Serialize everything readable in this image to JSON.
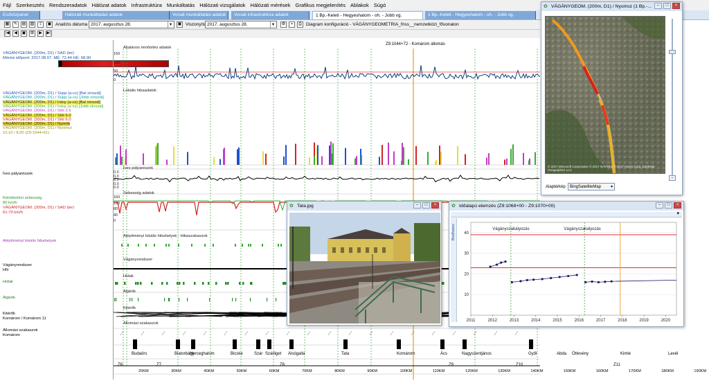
{
  "menu": [
    "Fájl",
    "Szerkesztés",
    "Rendszeradatok",
    "Hálózat adatok",
    "Infrastruktúra",
    "Munkáltatás",
    "Hálózati vizsgálatok",
    "Hálózati mérések",
    "Grafikus megjelenítés",
    "Ablakok",
    "Súgó"
  ],
  "tabs": [
    {
      "label": "Eszközpanel",
      "state": "ghost"
    },
    {
      "label": "Hálózati munkáltatási adatok",
      "state": "ghost"
    },
    {
      "label": "Vonali munkáltatási adatok",
      "state": "ghost"
    },
    {
      "label": "Vonali infrastruktúra adatok",
      "state": "ghost"
    },
    {
      "label": "1 Bp.-Keleti - Hegyeshalom - oh. - Jobb vg.",
      "state": "active"
    },
    {
      "label": "1 Bp.-Keleti - Hegyeshalom - oh. - Jobb vg.",
      "state": "ghost"
    }
  ],
  "toolbar": {
    "analysis_label": "Analízis dátuma",
    "analysis_date": "2017.  augusztus  28.",
    "ref_label": "Viszonyítási dátum",
    "ref_date": "2017.  augusztus  28.",
    "diagram_config": "Diagram konfiguráció - VÁGÁNYGEOMETRIA_friss__nemzetközi_fővonalon"
  },
  "left_panel": {
    "header1": "VÁGÁNYGEOM. (200m, D1) / SAD (ter)",
    "header2": "Mérési időpont: 2017.08.07.  MÉ: 72,44  HÉ: 68,90",
    "legend": [
      {
        "text": "VÁGÁNYGEOM. (200m, D1) / Süpp (a-cs) [Bal sínszál]",
        "color": "#1f4fd0",
        "bg": ""
      },
      {
        "text": "VÁGÁNYGEOM. (200m, D1) / Süpp (a-cs) [Jobb sínszál]",
        "color": "#0a9ea8",
        "bg": ""
      },
      {
        "text": "VÁGÁNYGEOM. (200m, D1) / Irány (a-cs) [Bal sínszál]",
        "color": "#222",
        "bg": "#f2ee4b"
      },
      {
        "text": "VÁGÁNYGEOM. (200m, D1) / Irány (a-cs) [Jobb sínszál]",
        "color": "#38a836",
        "bg": ""
      },
      {
        "text": "VÁGÁNYGEOM. (200m, D1) / Síkt 2.5",
        "color": "#c33bc3",
        "bg": ""
      },
      {
        "text": "VÁGÁNYGEOM. (200m, D1) / Síkt 6.0",
        "color": "#222",
        "bg": "#f2ee4b"
      },
      {
        "text": "VÁGÁNYGEOM. (200m, D1) / Síkt 6.0",
        "color": "#d02222",
        "bg": ""
      },
      {
        "text": "VÁGÁNYGEOM. (200m, D1) / Nyomb",
        "color": "#222",
        "bg": "#e7dd3b"
      },
      {
        "text": "VÁGÁNYGEOM. (200m, D1) / Nyomsz",
        "color": "#9b8f12",
        "bg": ""
      },
      {
        "text": "10,10 / 8,00 (Z9:1044+61)",
        "color": "#9b8f12",
        "bg": ""
      }
    ],
    "ives": "Íves pályarészek",
    "speed1": "Kiértékelési sebesség",
    "speed2": "80 km/h",
    "speed3": "VÁGÁNYGEOM. (200m, D1) / SAD (ter)",
    "speed4": "61-70 km/h",
    "alep": "Alépítményi lokális hibahelyek",
    "vagany": "Vágányrendszer",
    "hn": "HN",
    "hidak": "Hidak",
    "atjarok": "Átjárók",
    "kiterok": "Kitérők",
    "kiterok2": "Komárom / Komárom 11",
    "allomas": "Állomási szakaszok",
    "komarom": "Komárom"
  },
  "plot": {
    "top_label": "Z9:1044+72 - Komárom állomás",
    "row_titles": [
      "Általános minősítés adatok",
      "Lokális hibaadatok",
      "Íves pályarészek",
      "Sebesség adatok",
      "Alépítményi lokális hibahelyek - Hibaszakaszok",
      "Vágányrendszer",
      "Hidak",
      "Átjárók",
      "Kitérők",
      "Állomási szakaszok"
    ],
    "y_general": [
      "150",
      "100",
      "50",
      "0"
    ],
    "y_ives": [
      "0.0",
      "0.0",
      "0.0",
      "0.0",
      "0.0"
    ],
    "y_speed": [
      "160",
      "120",
      "80",
      "40",
      "0"
    ],
    "stations": [
      "Budaörs",
      "Biatorbágy",
      "Herceghalom",
      "Bicske",
      "Szár",
      "Szárliget",
      "Alsógalla",
      "Tata",
      "Komárom",
      "Ács",
      "Nagyszentjános",
      "Győr",
      "Abda",
      "Öttevény",
      "Kimle",
      "Levél"
    ],
    "zones": [
      "Z6",
      "Z7",
      "Z8",
      "Z9",
      "Z10",
      "Z11"
    ],
    "km": [
      "20KM",
      "30KM",
      "40KM",
      "50KM",
      "60KM",
      "70KM",
      "80KM",
      "90KM",
      "100KM",
      "110KM",
      "120KM",
      "130KM",
      "140KM",
      "150KM",
      "160KM",
      "170KM",
      "180KM",
      "190KM"
    ]
  },
  "map_win": {
    "title": "VÁGÁNYGEOM. (200m, D1) / Nyomsz (1 Bp.-...",
    "map_label": "Alaptérkép",
    "map_value": "BingSatelliteMap",
    "copyright": "© 2017 Microsoft Corporation  © 2017 NAVTEQ  © 2017 Harris Corp, Earthstar Geographics LLC"
  },
  "photo_win": {
    "title": "Tata.jpg"
  },
  "time_win": {
    "title": "Időalapú elemzés (Z9:1068+00 - Z9:1070+00)",
    "ylabel": "Bodhossz",
    "annot1": "Vágányszabályozás",
    "annot2": "Vágányszabályozás",
    "years": [
      "2011",
      "2012",
      "2013",
      "2014",
      "2015",
      "2016",
      "2017",
      "2018",
      "2019",
      "2020"
    ],
    "yticks": [
      "40",
      "30",
      "20",
      "10"
    ],
    "points": [
      {
        "x": 2011.9,
        "y": 23.5
      },
      {
        "x": 2012.2,
        "y": 24.5
      },
      {
        "x": 2012.4,
        "y": 25.5
      },
      {
        "x": 2012.6,
        "y": 26
      },
      {
        "x": 2012.9,
        "y": 16
      },
      {
        "x": 2013.3,
        "y": 16.5
      },
      {
        "x": 2013.6,
        "y": 17
      },
      {
        "x": 2013.9,
        "y": 17.2
      },
      {
        "x": 2014.3,
        "y": 17.5
      },
      {
        "x": 2014.7,
        "y": 18
      },
      {
        "x": 2015.1,
        "y": 18.5
      },
      {
        "x": 2015.5,
        "y": 19
      },
      {
        "x": 2015.9,
        "y": 19.5
      },
      {
        "x": 2016.3,
        "y": 16
      },
      {
        "x": 2016.6,
        "y": 16.3
      },
      {
        "x": 2016.9,
        "y": 16
      },
      {
        "x": 2017.2,
        "y": 16.2
      },
      {
        "x": 2017.5,
        "y": 16.4
      }
    ]
  }
}
